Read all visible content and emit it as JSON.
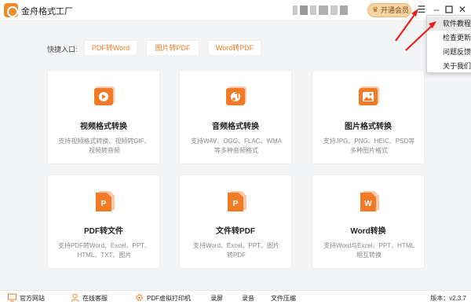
{
  "app": {
    "title": "金舟格式工厂",
    "vip_label": "开通会员"
  },
  "menu": {
    "items": [
      "软件教程",
      "检查更新",
      "问题反馈",
      "关于我们"
    ],
    "active_index": 0
  },
  "quick": {
    "label": "快捷入口:",
    "buttons": [
      "PDF转Word",
      "图片转PDF",
      "Word转PDF"
    ]
  },
  "cards": [
    {
      "title": "视频格式转换",
      "desc_lines": [
        "支持视频格式转换、视频转GIF、",
        "视频转音频"
      ],
      "icon": "video-icon"
    },
    {
      "title": "音频格式转换",
      "desc_lines": [
        "支持WAV、OGG、FLAC、WMA",
        "等多种音频格式"
      ],
      "icon": "music-icon"
    },
    {
      "title": "图片格式转换",
      "desc_lines": [
        "支持JPG、PNG、HEIC、PSD等",
        "多种图片格式"
      ],
      "icon": "image-icon"
    },
    {
      "title": "PDF转文件",
      "desc_lines": [
        "支持PDF转Word、Excel、PPT、",
        "HTML、TXT、图片"
      ],
      "icon": "pdf-icon"
    },
    {
      "title": "文件转PDF",
      "desc_lines": [
        "支持Word、Excel、PPT、图片",
        "转PDF"
      ],
      "icon": "file-to-pdf-icon"
    },
    {
      "title": "Word转换",
      "desc_lines": [
        "支持Word与Excel、PPT、HTML",
        "相互转换"
      ],
      "icon": "word-icon"
    }
  ],
  "card_icon_letters": [
    "P",
    "P",
    "W"
  ],
  "bottom": {
    "items": [
      "官方网站",
      "在线客服",
      "PDF虚拟打印机",
      "录屏",
      "录音",
      "文件压缩"
    ],
    "version": "版本：v2.3.7"
  },
  "colors": {
    "accent": "#f07a26",
    "vip_bg": "#f6d3a3",
    "arrow": "#e8201c"
  }
}
